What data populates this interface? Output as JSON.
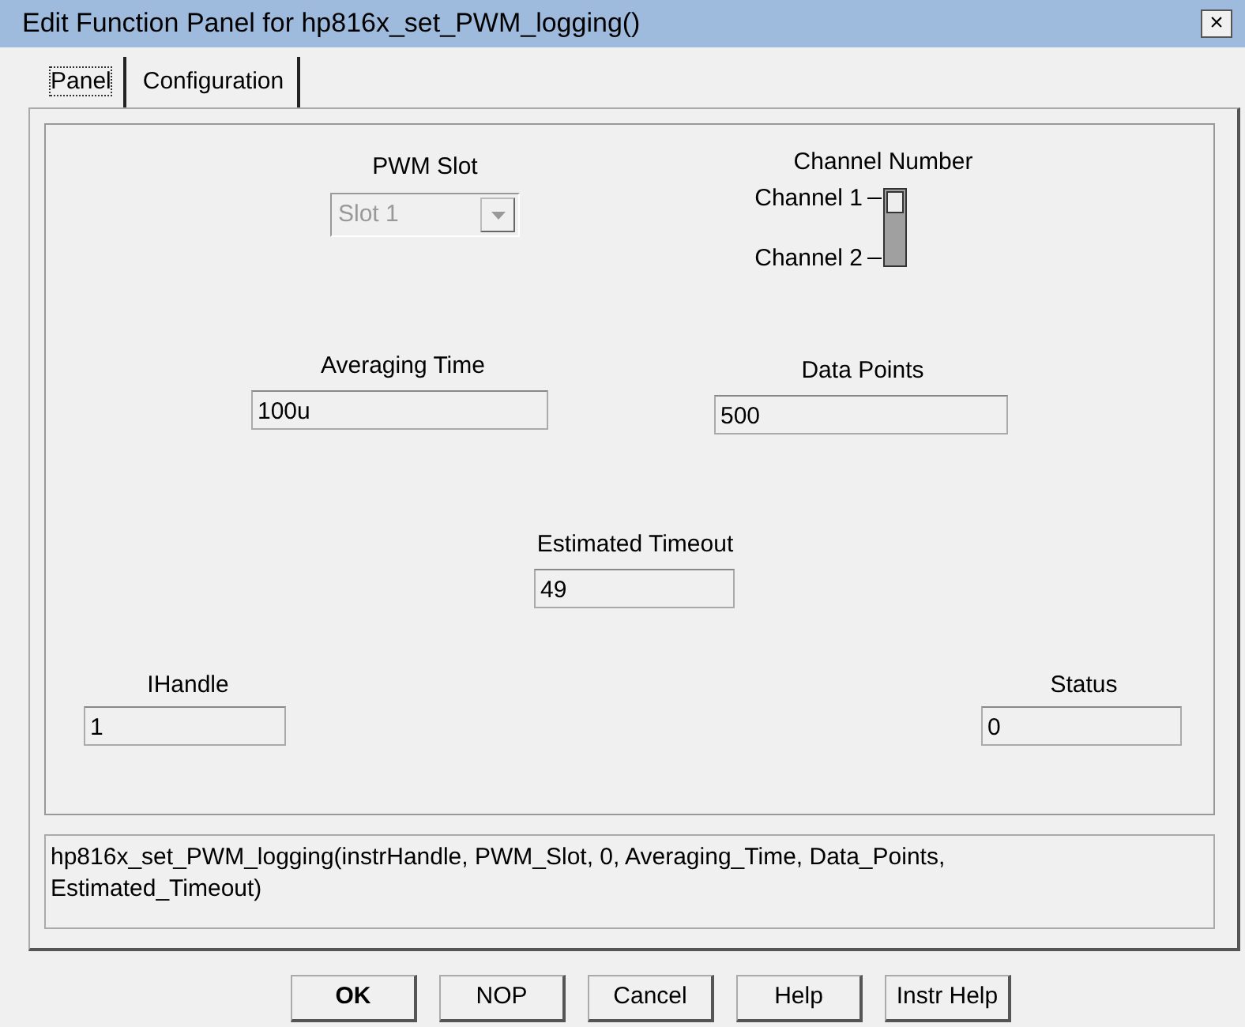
{
  "window": {
    "title": "Edit Function Panel for hp816x_set_PWM_logging()",
    "close": "×"
  },
  "tabs": [
    {
      "label": "Panel",
      "selected": true
    },
    {
      "label": "Configuration",
      "selected": false
    }
  ],
  "controls": [
    {
      "kind": "combo",
      "label": "PWM Slot",
      "value": "Slot 1",
      "disabled": true
    },
    {
      "kind": "switch",
      "label": "Channel Number",
      "options": [
        {
          "label": "Channel 1",
          "selected": true
        },
        {
          "label": "Channel 2",
          "selected": false
        }
      ]
    },
    {
      "kind": "field",
      "label": "Averaging Time",
      "value": "100u"
    },
    {
      "kind": "field",
      "label": "Data Points",
      "value": "500"
    },
    {
      "kind": "field",
      "label": "Estimated Timeout",
      "value": "49"
    },
    {
      "kind": "field",
      "label": "IHandle",
      "value": "1"
    },
    {
      "kind": "field",
      "label": "Status",
      "value": "0"
    }
  ],
  "prototype": "hp816x_set_PWM_logging(instrHandle, PWM_Slot, 0, Averaging_Time, Data_Points, Estimated_Timeout)",
  "buttons": [
    {
      "label": "OK",
      "default": true
    },
    {
      "label": "NOP",
      "default": false
    },
    {
      "label": "Cancel",
      "default": false
    },
    {
      "label": "Help",
      "default": false
    },
    {
      "label": "Instr Help",
      "default": false
    }
  ]
}
